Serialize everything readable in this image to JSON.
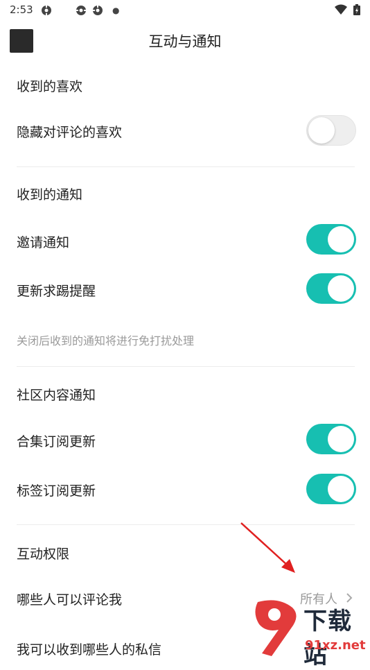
{
  "status_bar": {
    "time": "2:53"
  },
  "header": {
    "title": "互动与通知"
  },
  "sections": {
    "likes": {
      "title": "收到的喜欢",
      "hide_comment_likes": {
        "label": "隐藏对评论的喜欢",
        "enabled": false
      }
    },
    "notifications": {
      "title": "收到的通知",
      "invite": {
        "label": "邀请通知",
        "enabled": true
      },
      "update_request": {
        "label": "更新求踢提醒",
        "enabled": true
      },
      "hint": "关闭后收到的通知将进行免打扰处理"
    },
    "community": {
      "title": "社区内容通知",
      "collection": {
        "label": "合集订阅更新",
        "enabled": true
      },
      "tag": {
        "label": "标签订阅更新",
        "enabled": true
      }
    },
    "permissions": {
      "title": "互动权限",
      "who_can_comment": {
        "label": "哪些人可以评论我",
        "value": "所有人"
      },
      "private_messages": {
        "label": "我可以收到哪些人的私信"
      }
    }
  },
  "watermark": {
    "text": "下载站",
    "url": "91xz.net"
  },
  "colors": {
    "accent": "#17bfb1",
    "arrow": "#e02020",
    "hint": "#9a9a9a"
  },
  "icons": [
    "app-icon",
    "wifi-icon",
    "battery-icon",
    "back-icon",
    "chevron-right-icon",
    "arrow-pointer-icon"
  ]
}
